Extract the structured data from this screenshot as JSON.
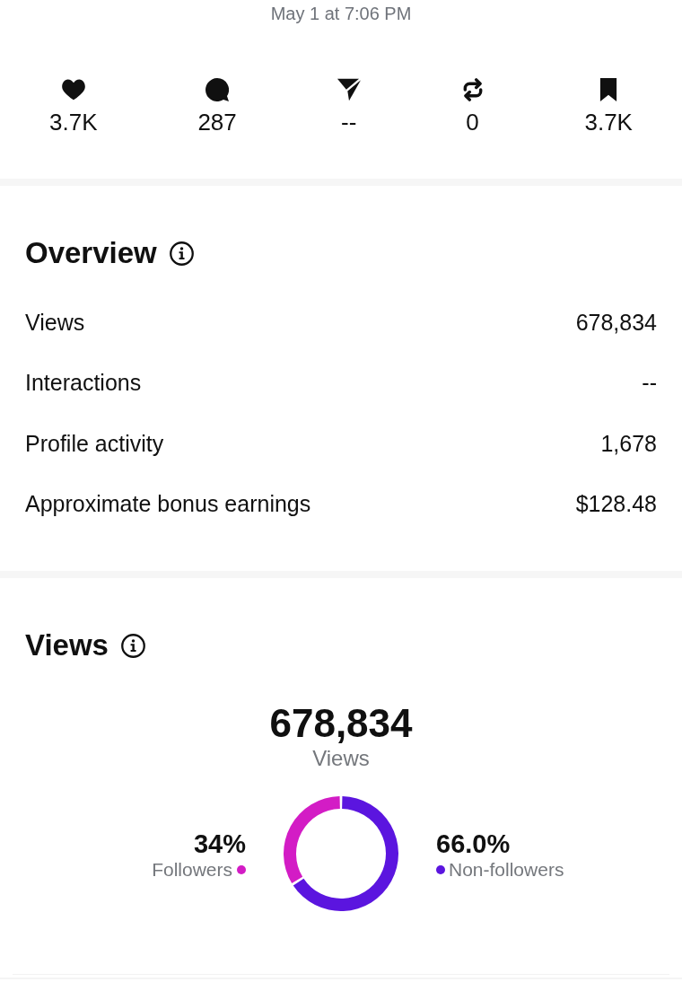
{
  "post": {
    "timestamp": "May 1 at 7:06 PM"
  },
  "stats": [
    {
      "kind": "likes",
      "value": "3.7K"
    },
    {
      "kind": "replies",
      "value": "287"
    },
    {
      "kind": "shares",
      "value": "--"
    },
    {
      "kind": "reposts",
      "value": "0"
    },
    {
      "kind": "saves",
      "value": "3.7K"
    }
  ],
  "overview": {
    "title": "Overview",
    "rows": [
      {
        "label": "Views",
        "value": "678,834"
      },
      {
        "label": "Interactions",
        "value": "--"
      },
      {
        "label": "Profile activity",
        "value": "1,678"
      },
      {
        "label": "Approximate bonus earnings",
        "value": "$128.48"
      }
    ]
  },
  "views": {
    "title": "Views",
    "total": "678,834",
    "total_label": "Views",
    "legend": [
      {
        "value": "34%",
        "color": "#d31cc5"
      },
      {
        "value": "66.0%",
        "color": "#5b15df"
      }
    ],
    "chart_data": {
      "type": "donut",
      "categories": [
        "Followers",
        "Non-followers"
      ],
      "values": [
        34,
        66
      ]
    }
  }
}
